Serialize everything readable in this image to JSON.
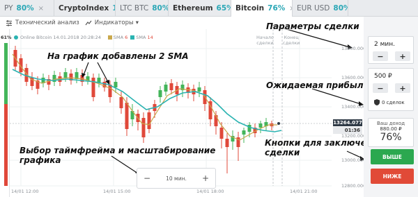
{
  "tabs": [
    {
      "name": "PY",
      "pct": "80%",
      "active": false,
      "strong": false
    },
    {
      "name": "CryptoIndex",
      "pct": "10%",
      "active": false,
      "strong": true
    },
    {
      "name": "LTC BTC",
      "pct": "80%",
      "active": false,
      "strong": false
    },
    {
      "name": "Ethereum",
      "pct": "65%",
      "active": false,
      "strong": true
    },
    {
      "name": "Bitcoin",
      "pct": "76%",
      "active": true,
      "strong": true
    },
    {
      "name": "EUR USD",
      "pct": "80%",
      "active": false,
      "strong": false
    }
  ],
  "tab_close": "×",
  "toolbar": {
    "tech_analysis": "Технический анализ",
    "indicators": "Индикаторы",
    "dropdown_caret": "▾"
  },
  "left_pct": "61%",
  "legend": {
    "asset": "Online Bitcoin 14.01.2018 20:28:24",
    "sma1_label": "SMA",
    "sma1_period": "6",
    "sma2_label": "SMA",
    "sma2_period": "14"
  },
  "chart_markers": {
    "deadline": [
      "Начало",
      "сделки"
    ],
    "expiry": [
      "Конец",
      "сделки"
    ]
  },
  "y_labels": [
    "13800.000",
    "13600.000",
    "13400.000",
    "13200.000",
    "13000.000",
    "12800.000"
  ],
  "x_labels": [
    "14/01 12:00",
    "14/01 15:00",
    "14/01 18:00",
    "14/01 21:00"
  ],
  "current_price": "13264.077",
  "countdown": "01:36",
  "zoom": {
    "minus": "−",
    "value": "10 мин.",
    "plus": "+"
  },
  "annotations": {
    "sma": "На график добавлены 2 SMA",
    "timeframe": "Выбор таймфрейма и масштабирование\nграфика",
    "params": "Параметры сделки",
    "profit": "Ожидаемая прибыль",
    "buttons": "Кнопки для заключения\nсделки"
  },
  "panel": {
    "duration": "2 мин.",
    "amount": "500 ₽",
    "minus": "−",
    "plus": "+",
    "deals": "0 сделок",
    "income_label": "Ваш доход",
    "income_value": "880.00 ₽",
    "income_pct": "76%",
    "up_label": "ВЫШЕ",
    "down_label": "НИЖЕ"
  },
  "colors": {
    "accent": "#2aa7b6",
    "candle_up": "#43b55a",
    "candle_down": "#e0483a",
    "sma6": "#c9a84c",
    "sma14": "#2ab3b1"
  }
}
